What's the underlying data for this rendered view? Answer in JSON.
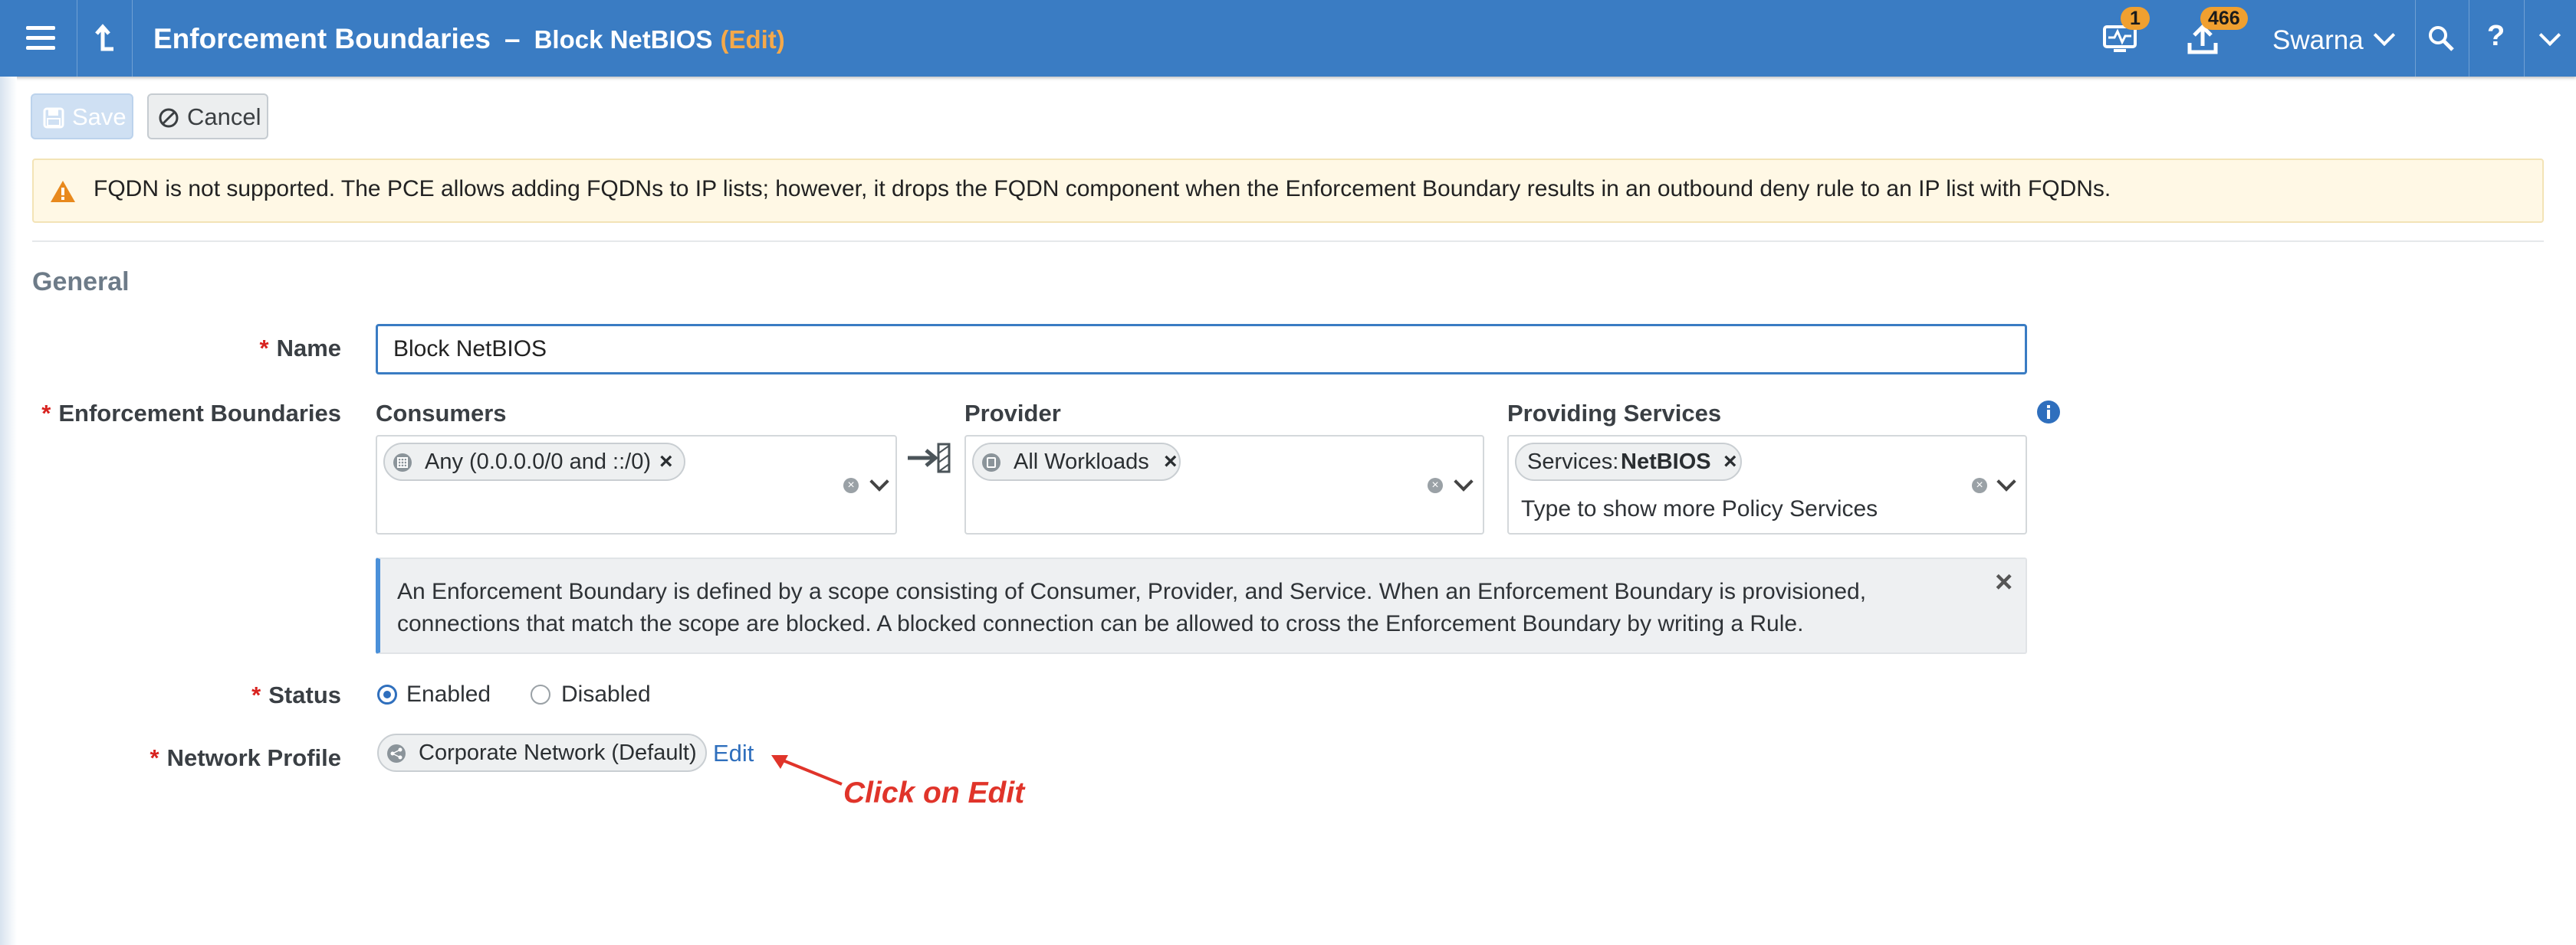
{
  "header": {
    "title": "Enforcement Boundaries",
    "separator": "–",
    "subtitle": "Block NetBIOS",
    "mode": "(Edit)",
    "alerts_badge": "1",
    "provision_badge": "466",
    "user": "Swarna",
    "accent_color": "#3a7cc3"
  },
  "toolbar": {
    "save_label": "Save",
    "cancel_label": "Cancel"
  },
  "warning": {
    "icon": "warning-triangle-icon",
    "text": "FQDN is not supported. The PCE allows adding FQDNs to IP lists; however, it drops the FQDN component when the Enforcement Boundary results in an outbound deny rule to an IP list with FQDNs."
  },
  "general": {
    "section_title": "General",
    "required_mark": "*",
    "name_label": "Name",
    "name_value": "Block NetBIOS",
    "boundaries_label": "Enforcement Boundaries",
    "consumers_label": "Consumers",
    "consumers_chip": "Any (0.0.0.0/0 and ::/0)",
    "provider_label": "Provider",
    "provider_chip": "All Workloads",
    "services_label": "Providing Services",
    "services_chip_prefix": "Services:",
    "services_chip_value": "NetBIOS",
    "services_placeholder": "Type to show more Policy Services",
    "chip_remove": "×",
    "info_text_line1": "An Enforcement Boundary is defined by a scope consisting of Consumer, Provider, and Service. When an Enforcement Boundary is provisioned,",
    "info_text_line2": "connections that match the scope are blocked. A blocked connection can be allowed to cross the Enforcement Boundary by writing a Rule.",
    "info_close": "×",
    "status_label": "Status",
    "status_enabled": "Enabled",
    "status_disabled": "Disabled",
    "status_selected": "Enabled",
    "network_profile_label": "Network Profile",
    "network_profile_chip": "Corporate Network (Default)",
    "network_profile_edit": "Edit"
  },
  "annotation": {
    "text": "Click on Edit",
    "color": "#e0342a"
  }
}
